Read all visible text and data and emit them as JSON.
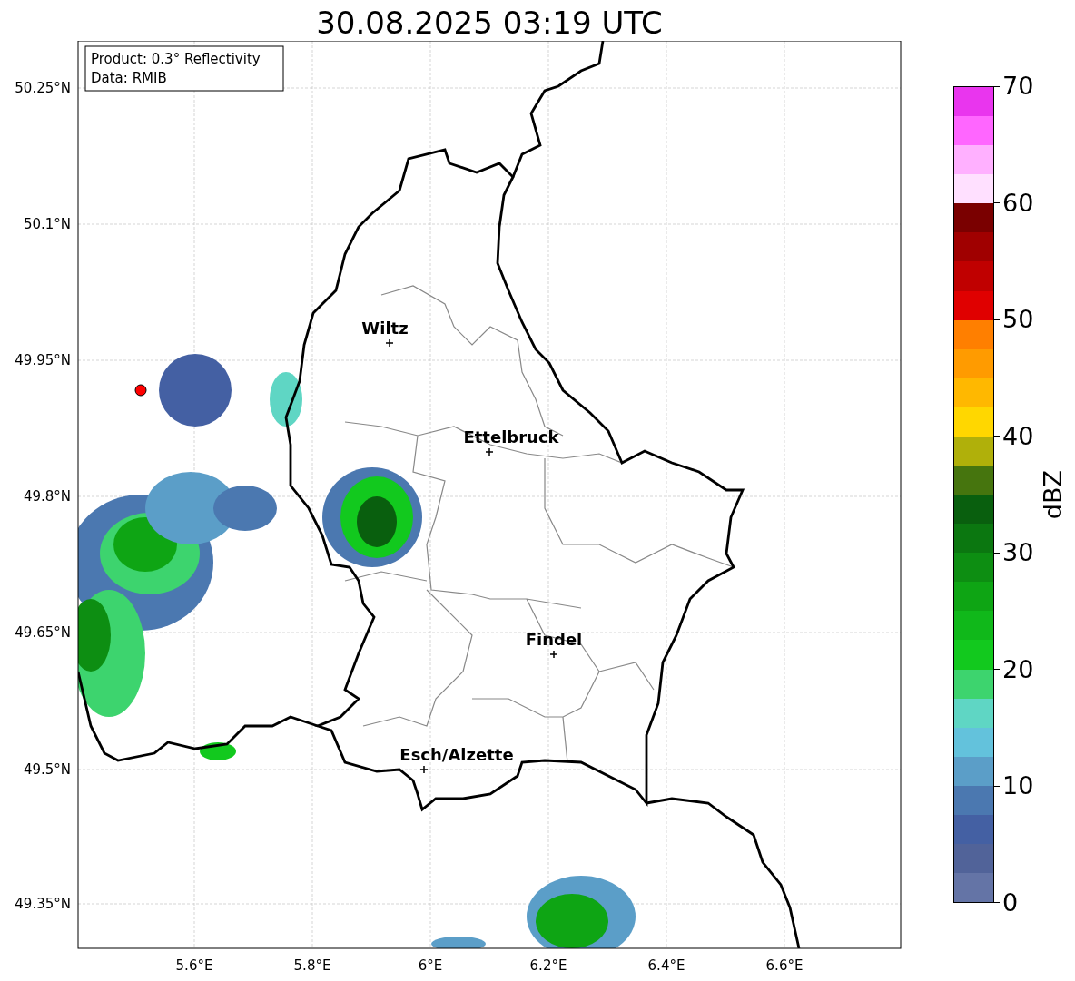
{
  "title": "30.08.2025 03:19 UTC",
  "info_box": [
    "Product: 0.3° Reflectivity",
    "Data: RMIB"
  ],
  "map": {
    "cities": [
      {
        "name": "Wiltz"
      },
      {
        "name": "Ettelbruck"
      },
      {
        "name": "Findel"
      },
      {
        "name": "Esch/Alzette"
      }
    ],
    "x_ticks": [
      "5.6°E",
      "5.8°E",
      "6°E",
      "6.2°E",
      "6.4°E",
      "6.6°E"
    ],
    "y_ticks": [
      "50.25°N",
      "50.1°N",
      "49.95°N",
      "49.8°N",
      "49.65°N",
      "49.5°N",
      "49.35°N"
    ]
  },
  "colorbar": {
    "label": "dBZ",
    "ticks": [
      "70",
      "60",
      "50",
      "40",
      "30",
      "20",
      "10",
      "0"
    ],
    "bins": [
      {
        "color": "#e935ee"
      },
      {
        "color": "#ff66ff"
      },
      {
        "color": "#ffb0ff"
      },
      {
        "color": "#ffe0ff"
      },
      {
        "color": "#7a0000"
      },
      {
        "color": "#a00000"
      },
      {
        "color": "#c00000"
      },
      {
        "color": "#e00000"
      },
      {
        "color": "#ff7f00"
      },
      {
        "color": "#ff9b00"
      },
      {
        "color": "#ffb800"
      },
      {
        "color": "#ffd700"
      },
      {
        "color": "#b0b00a"
      },
      {
        "color": "#46750e"
      },
      {
        "color": "#095f0e"
      },
      {
        "color": "#0b7710"
      },
      {
        "color": "#0d8e12"
      },
      {
        "color": "#0ea514"
      },
      {
        "color": "#10b81a"
      },
      {
        "color": "#12c91e"
      },
      {
        "color": "#3dd46e"
      },
      {
        "color": "#5fd6c4"
      },
      {
        "color": "#63c2dc"
      },
      {
        "color": "#5b9ec8"
      },
      {
        "color": "#4b78b0"
      },
      {
        "color": "#4460a3"
      },
      {
        "color": "#516399"
      },
      {
        "color": "#6474a6"
      }
    ]
  }
}
